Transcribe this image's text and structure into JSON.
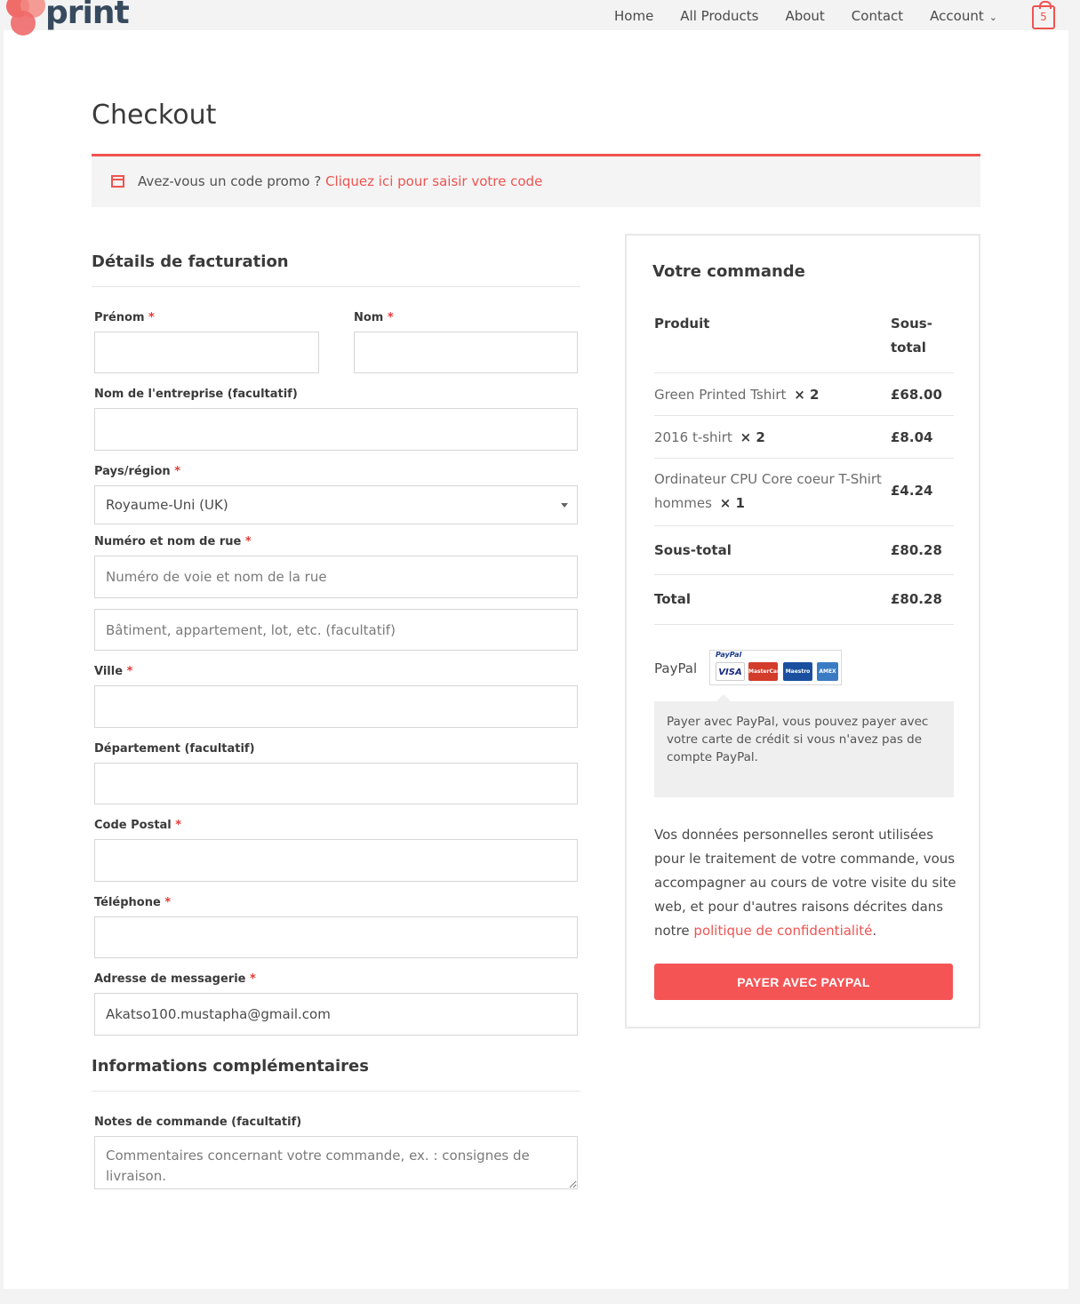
{
  "brand": {
    "name": "print",
    "accent": "#ef5350"
  },
  "nav": {
    "items": [
      "Home",
      "All Products",
      "About",
      "Contact",
      "Account"
    ],
    "cart_count": "5"
  },
  "page_title": "Checkout",
  "promo": {
    "question": "Avez-vous un code promo ?",
    "link": "Cliquez ici pour saisir votre code"
  },
  "billing": {
    "title": "Détails de facturation",
    "first_name_label": "Prénom",
    "last_name_label": "Nom",
    "company_label": "Nom de l'entreprise (facultatif)",
    "country_label": "Pays/région",
    "country_value": "Royaume-Uni (UK)",
    "street_label": "Numéro et nom de rue",
    "street_placeholder": "Numéro de voie et nom de la rue",
    "street2_placeholder": "Bâtiment, appartement, lot, etc. (facultatif)",
    "city_label": "Ville",
    "state_label": "Département (facultatif)",
    "postcode_label": "Code Postal",
    "phone_label": "Téléphone",
    "email_label": "Adresse de messagerie",
    "email_value": "Akatso100.mustapha@gmail.com",
    "required_mark": "*"
  },
  "additional": {
    "title": "Informations complémentaires",
    "notes_label": "Notes de commande (facultatif)",
    "notes_placeholder": "Commentaires concernant votre commande, ex. : consignes de livraison."
  },
  "order": {
    "title": "Votre commande",
    "col_product": "Produit",
    "col_subtotal": "Sous-total",
    "items": [
      {
        "name": "Green Printed Tshirt",
        "qty": "× 2",
        "price": "£68.00"
      },
      {
        "name": "2016 t-shirt",
        "qty": "× 2",
        "price": "£8.04"
      },
      {
        "name": "Ordinateur CPU Core coeur T-Shirt hommes",
        "qty": "× 1",
        "price": "£4.24"
      }
    ],
    "subtotal_label": "Sous-total",
    "subtotal_value": "£80.28",
    "total_label": "Total",
    "total_value": "£80.28",
    "payment_method": "PayPal",
    "paypal_brand": "PayPal",
    "cards": [
      "VISA",
      "MasterCard",
      "Maestro",
      "AMEX"
    ],
    "paypal_desc": "Payer avec PayPal, vous pouvez payer avec votre carte de crédit si vous n'avez pas de compte PayPal.",
    "privacy_text": "Vos données personnelles seront utilisées pour le traitement de votre commande, vous accompagner au cours de votre visite du site web, et pour d'autres raisons décrites dans notre",
    "privacy_link": "politique de confidentialité",
    "privacy_end": ".",
    "pay_button": "PAYER AVEC PAYPAL"
  }
}
